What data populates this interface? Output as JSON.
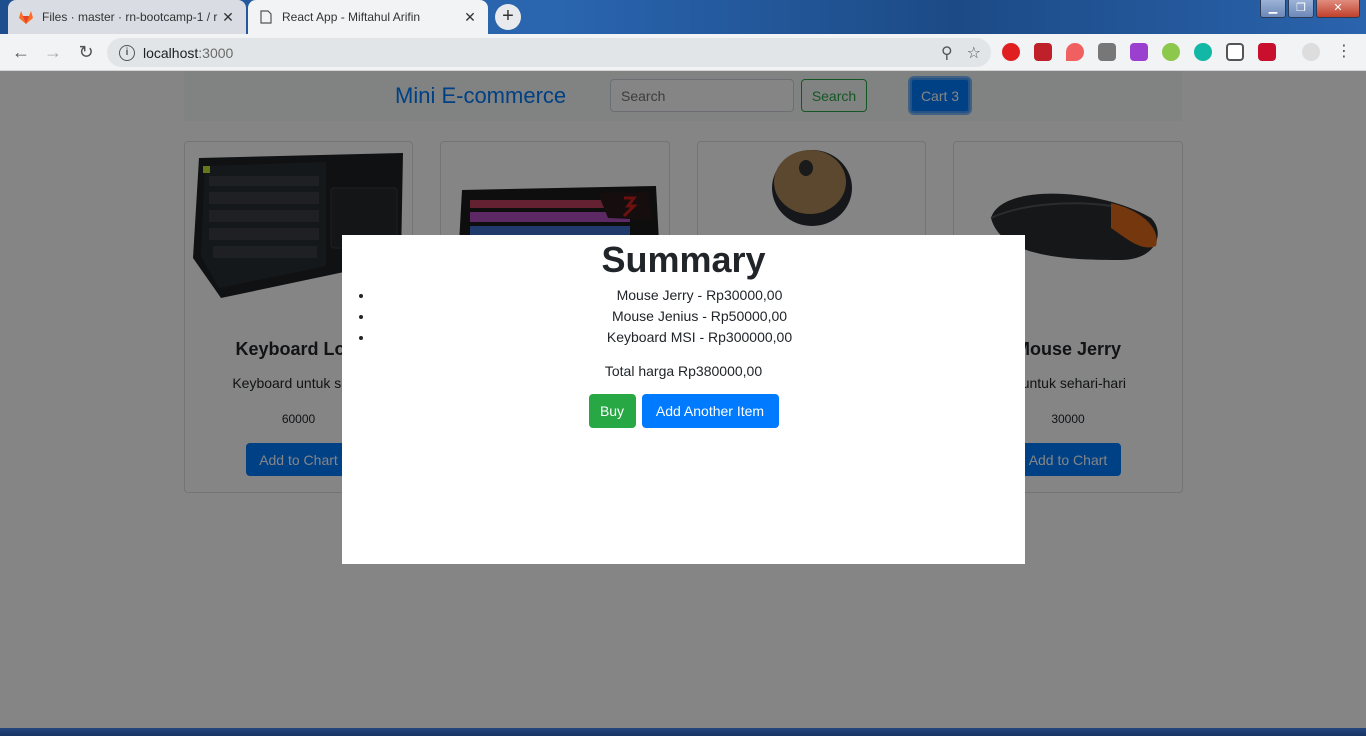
{
  "browser": {
    "tabs": [
      {
        "title": "Files · master · rn-bootcamp-1 / r",
        "active": false
      },
      {
        "title": "React App - Miftahul Arifin",
        "active": true
      }
    ],
    "new_tab": "+",
    "url_host": "localhost",
    "url_port": ":3000"
  },
  "app": {
    "brand": "Mini E-commerce",
    "search_placeholder": "Search",
    "search_button": "Search",
    "cart_button": "Cart 3"
  },
  "products": [
    {
      "title": "Keyboard Logi",
      "description": "Keyboard untuk seha",
      "price": "60000",
      "button": "Add to Chart"
    },
    {
      "title": "",
      "description": "",
      "price": "",
      "button": ""
    },
    {
      "title": "",
      "description": "",
      "price": "",
      "button": ""
    },
    {
      "title": "Mouse Jerry",
      "description": "e untuk sehari-hari",
      "price": "30000",
      "button": "Add to Chart"
    }
  ],
  "modal": {
    "title": "Summary",
    "items": [
      "Mouse Jerry - Rp30000,00",
      "Mouse Jenius - Rp50000,00",
      "Keyboard MSI - Rp300000,00"
    ],
    "total": "Total harga Rp380000,00",
    "buy_button": "Buy",
    "add_another_button": "Add Another Item"
  },
  "colors": {
    "primary": "#007bff",
    "success": "#28a745"
  }
}
